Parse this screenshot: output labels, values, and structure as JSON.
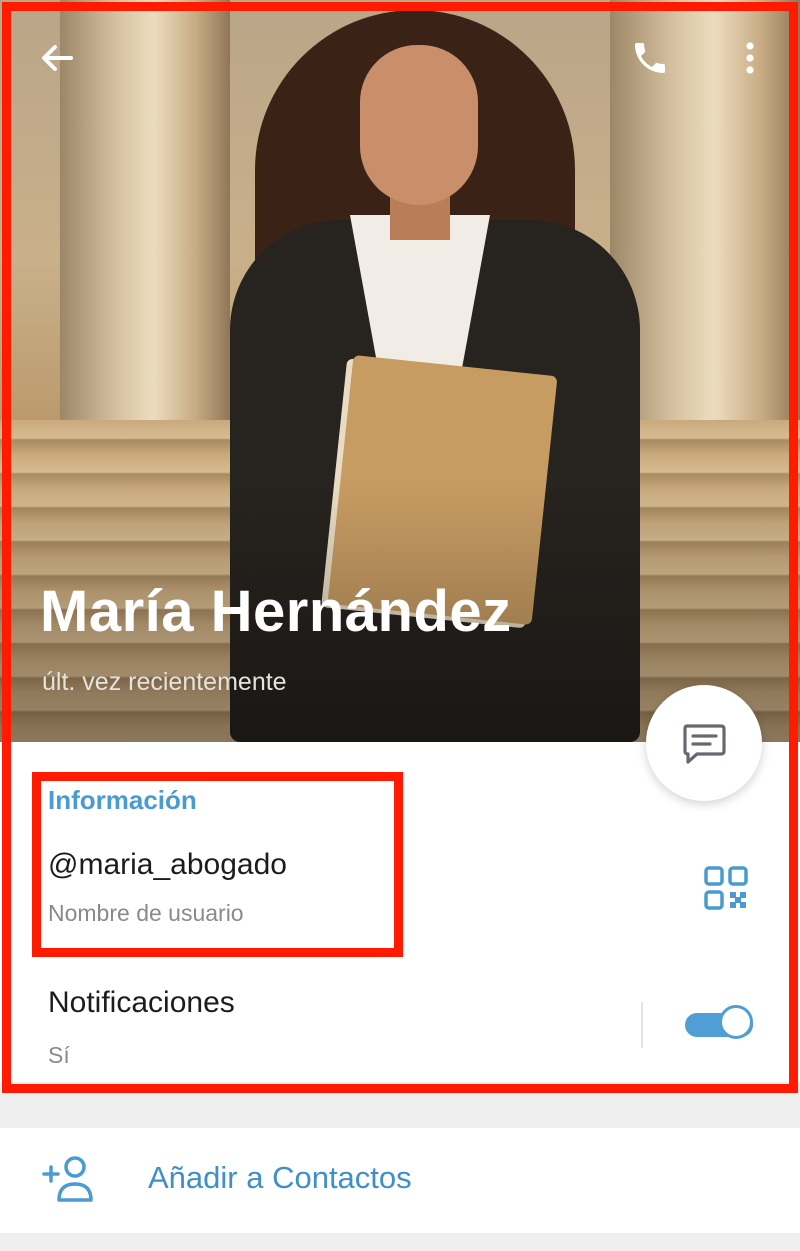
{
  "profile": {
    "name": "María Hernández",
    "status": "últ. vez recientemente"
  },
  "info": {
    "section_title": "Información",
    "username": "@maria_abogado",
    "username_label": "Nombre de usuario"
  },
  "notifications": {
    "title": "Notificaciones",
    "value": "Sí",
    "enabled": true
  },
  "actions": {
    "add_contact_label": "Añadir a Contactos"
  },
  "icons": {
    "back": "arrow-left-icon",
    "call": "phone-icon",
    "more": "more-vertical-icon",
    "message": "message-icon",
    "qr": "qr-code-icon",
    "add_contact": "add-person-icon"
  },
  "colors": {
    "accent": "#4a9bd1",
    "annotation": "#ff1a00"
  }
}
